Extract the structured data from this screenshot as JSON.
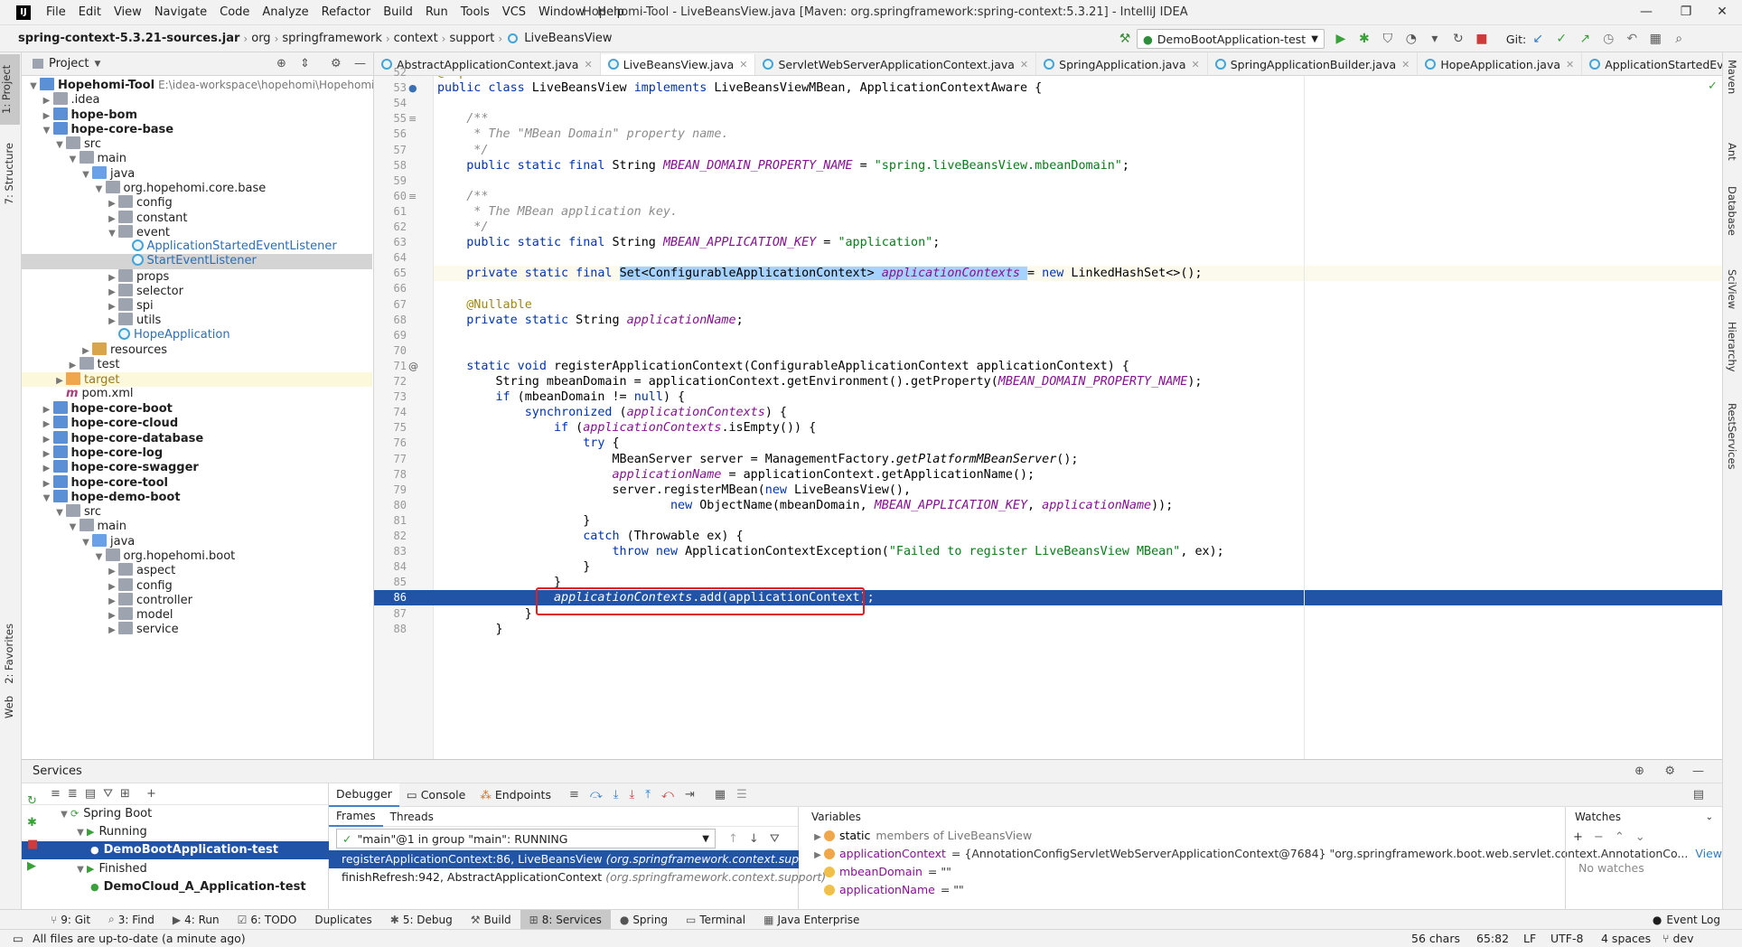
{
  "menubar": {
    "app_logo": "IJ",
    "items": [
      "File",
      "Edit",
      "View",
      "Navigate",
      "Code",
      "Analyze",
      "Refactor",
      "Build",
      "Run",
      "Tools",
      "VCS",
      "Window",
      "Help"
    ],
    "title": "Hopehomi-Tool - LiveBeansView.java [Maven: org.springframework:spring-context:5.3.21] - IntelliJ IDEA"
  },
  "navbar": {
    "crumbs": [
      "spring-context-5.3.21-sources.jar",
      "org",
      "springframework",
      "context",
      "support",
      "LiveBeansView"
    ],
    "run_config": "DemoBootApplication-test",
    "git_label": "Git:"
  },
  "left_tabs": [
    "1: Project",
    "7: Structure",
    "2: Favorites",
    "Web"
  ],
  "right_tabs": [
    "Maven",
    "Ant",
    "Database",
    "SciView",
    "Hierarchy",
    "RestServices"
  ],
  "project": {
    "header": "Project",
    "tree": [
      {
        "text": "Hopehomi-Tool",
        "extra": "E:\\idea-workspace\\hopehomi\\Hopehomi-",
        "kind": "module",
        "level": 0,
        "arrow": "▼"
      },
      {
        "text": ".idea",
        "kind": "folder",
        "level": 1,
        "arrow": "▶"
      },
      {
        "text": "hope-bom",
        "kind": "module",
        "level": 1,
        "arrow": "▶"
      },
      {
        "text": "hope-core-base",
        "kind": "module",
        "level": 1,
        "arrow": "▼"
      },
      {
        "text": "src",
        "kind": "folder",
        "level": 2,
        "arrow": "▼"
      },
      {
        "text": "main",
        "kind": "folder",
        "level": 3,
        "arrow": "▼"
      },
      {
        "text": "java",
        "kind": "src",
        "level": 4,
        "arrow": "▼"
      },
      {
        "text": "org.hopehomi.core.base",
        "kind": "folder",
        "level": 5,
        "arrow": "▼"
      },
      {
        "text": "config",
        "kind": "folder",
        "level": 6,
        "arrow": "▶"
      },
      {
        "text": "constant",
        "kind": "folder",
        "level": 6,
        "arrow": "▶"
      },
      {
        "text": "event",
        "kind": "folder",
        "level": 6,
        "arrow": "▼"
      },
      {
        "text": "ApplicationStartedEventListener",
        "kind": "class",
        "level": 7,
        "arrow": ""
      },
      {
        "text": "StartEventListener",
        "kind": "class",
        "level": 7,
        "arrow": "",
        "selected": true
      },
      {
        "text": "props",
        "kind": "folder",
        "level": 6,
        "arrow": "▶"
      },
      {
        "text": "selector",
        "kind": "folder",
        "level": 6,
        "arrow": "▶"
      },
      {
        "text": "spi",
        "kind": "folder",
        "level": 6,
        "arrow": "▶"
      },
      {
        "text": "utils",
        "kind": "folder",
        "level": 6,
        "arrow": "▶"
      },
      {
        "text": "HopeApplication",
        "kind": "class",
        "level": 6,
        "arrow": ""
      },
      {
        "text": "resources",
        "kind": "res",
        "level": 4,
        "arrow": "▶"
      },
      {
        "text": "test",
        "kind": "folder",
        "level": 3,
        "arrow": "▶"
      },
      {
        "text": "target",
        "kind": "target",
        "level": 2,
        "arrow": "▶",
        "highlight": true
      },
      {
        "text": "pom.xml",
        "kind": "pom",
        "level": 2,
        "arrow": ""
      },
      {
        "text": "hope-core-boot",
        "kind": "module",
        "level": 1,
        "arrow": "▶"
      },
      {
        "text": "hope-core-cloud",
        "kind": "module",
        "level": 1,
        "arrow": "▶"
      },
      {
        "text": "hope-core-database",
        "kind": "module",
        "level": 1,
        "arrow": "▶"
      },
      {
        "text": "hope-core-log",
        "kind": "module",
        "level": 1,
        "arrow": "▶"
      },
      {
        "text": "hope-core-swagger",
        "kind": "module",
        "level": 1,
        "arrow": "▶"
      },
      {
        "text": "hope-core-tool",
        "kind": "module",
        "level": 1,
        "arrow": "▶"
      },
      {
        "text": "hope-demo-boot",
        "kind": "module",
        "level": 1,
        "arrow": "▼"
      },
      {
        "text": "src",
        "kind": "folder",
        "level": 2,
        "arrow": "▼"
      },
      {
        "text": "main",
        "kind": "folder",
        "level": 3,
        "arrow": "▼"
      },
      {
        "text": "java",
        "kind": "src",
        "level": 4,
        "arrow": "▼"
      },
      {
        "text": "org.hopehomi.boot",
        "kind": "folder",
        "level": 5,
        "arrow": "▼"
      },
      {
        "text": "aspect",
        "kind": "folder",
        "level": 6,
        "arrow": "▶"
      },
      {
        "text": "config",
        "kind": "folder",
        "level": 6,
        "arrow": "▶"
      },
      {
        "text": "controller",
        "kind": "folder",
        "level": 6,
        "arrow": "▶"
      },
      {
        "text": "model",
        "kind": "folder",
        "level": 6,
        "arrow": "▶"
      },
      {
        "text": "service",
        "kind": "folder",
        "level": 6,
        "arrow": "▶"
      }
    ]
  },
  "editor": {
    "tabs": [
      "AbstractApplicationContext.java",
      "LiveBeansView.java",
      "ServletWebServerApplicationContext.java",
      "SpringApplication.java",
      "SpringApplicationBuilder.java",
      "HopeApplication.java",
      "ApplicationStartedEventListener"
    ],
    "active_tab": 1,
    "lines": [
      {
        "n": "52",
        "html": "<span class='ann'>@Deprecated</span>"
      },
      {
        "n": "53",
        "html": "<span class='kw'>public class</span> LiveBeansView <span class='kw'>implements</span> LiveBeansViewMBean, ApplicationContextAware {"
      },
      {
        "n": "54",
        "html": ""
      },
      {
        "n": "55",
        "html": "    <span class='cm'>/**</span>"
      },
      {
        "n": "56",
        "html": "<span class='cm'>     * The \"MBean Domain\" property name.</span>"
      },
      {
        "n": "57",
        "html": "<span class='cm'>     */</span>"
      },
      {
        "n": "58",
        "html": "    <span class='kw'>public static final</span> String <span class='fld'>MBEAN_DOMAIN_PROPERTY_NAME</span> = <span class='str'>\"spring.liveBeansView.mbeanDomain\"</span>;"
      },
      {
        "n": "59",
        "html": ""
      },
      {
        "n": "60",
        "html": "    <span class='cm'>/**</span>"
      },
      {
        "n": "61",
        "html": "<span class='cm'>     * The MBean application key.</span>"
      },
      {
        "n": "62",
        "html": "<span class='cm'>     */</span>"
      },
      {
        "n": "63",
        "html": "    <span class='kw'>public static final</span> String <span class='fld'>MBEAN_APPLICATION_KEY</span> = <span class='str'>\"application\"</span>;"
      },
      {
        "n": "64",
        "html": ""
      },
      {
        "n": "65",
        "html": "    <span class='kw'>private static final</span> <span class='sel-text'>Set&lt;ConfigurableApplicationContext&gt; <span class='fld'>applicationContexts</span> </span>= <span class='kw'>new</span> LinkedHashSet&lt;&gt;();",
        "cur": true
      },
      {
        "n": "66",
        "html": ""
      },
      {
        "n": "67",
        "html": "    <span class='ann'>@Nullable</span>"
      },
      {
        "n": "68",
        "html": "    <span class='kw'>private static</span> String <span class='fld'>applicationName</span>;"
      },
      {
        "n": "69",
        "html": ""
      },
      {
        "n": "70",
        "html": ""
      },
      {
        "n": "71",
        "html": "    <span class='kw'>static void</span> registerApplicationContext(ConfigurableApplicationContext applicationContext) {"
      },
      {
        "n": "72",
        "html": "        String mbeanDomain = applicationContext.getEnvironment().getProperty(<span class='fld'>MBEAN_DOMAIN_PROPERTY_NAME</span>);"
      },
      {
        "n": "73",
        "html": "        <span class='kw'>if</span> (mbeanDomain != <span class='kw'>null</span>) {"
      },
      {
        "n": "74",
        "html": "            <span class='kw'>synchronized</span> (<span class='fld'>applicationContexts</span>) {"
      },
      {
        "n": "75",
        "html": "                <span class='kw'>if</span> (<span class='fld'>applicationContexts</span>.isEmpty()) {"
      },
      {
        "n": "76",
        "html": "                    <span class='kw'>try</span> {"
      },
      {
        "n": "77",
        "html": "                        MBeanServer server = ManagementFactory.<i>getPlatformMBeanServer</i>();"
      },
      {
        "n": "78",
        "html": "                        <span class='fld'>applicationName</span> = applicationContext.getApplicationName();"
      },
      {
        "n": "79",
        "html": "                        server.registerMBean(<span class='kw'>new</span> LiveBeansView(),"
      },
      {
        "n": "80",
        "html": "                                <span class='kw'>new</span> ObjectName(mbeanDomain, <span class='fld'>MBEAN_APPLICATION_KEY</span>, <span class='fld'>applicationName</span>));"
      },
      {
        "n": "81",
        "html": "                    }"
      },
      {
        "n": "82",
        "html": "                    <span class='kw'>catch</span> (Throwable ex) {"
      },
      {
        "n": "83",
        "html": "                        <span class='kw'>throw new</span> ApplicationContextException(<span class='str'>\"Failed to register LiveBeansView MBean\"</span>, ex);"
      },
      {
        "n": "84",
        "html": "                    }"
      },
      {
        "n": "85",
        "html": "                }"
      },
      {
        "n": "86",
        "html": "                <i>applicationContexts</i>.add(applicationContext);",
        "exec": true
      },
      {
        "n": "87",
        "html": "            }"
      },
      {
        "n": "88",
        "html": "        }"
      }
    ]
  },
  "services": {
    "title": "Services",
    "tree": [
      {
        "text": "Spring Boot",
        "level": 0,
        "arrow": "▼"
      },
      {
        "text": "Running",
        "level": 1,
        "arrow": "▼"
      },
      {
        "text": "DemoBootApplication-test",
        "level": 2,
        "arrow": "",
        "selected": true
      },
      {
        "text": "Finished",
        "level": 1,
        "arrow": "▼"
      },
      {
        "text": "DemoCloud_A_Application-test",
        "level": 2,
        "arrow": "",
        "bold": true
      }
    ],
    "debug_tabs": [
      "Debugger",
      "Console",
      "Endpoints"
    ],
    "frames_tabs": [
      "Frames",
      "Threads"
    ],
    "thread_select": "\"main\"@1 in group \"main\": RUNNING",
    "frames": [
      {
        "text": "registerApplicationContext:86, LiveBeansView",
        "pkg": "(org.springframework.context.support)",
        "selected": true
      },
      {
        "text": "finishRefresh:942, AbstractApplicationContext",
        "pkg": "(org.springframework.context.support)"
      }
    ],
    "variables_title": "Variables",
    "variables": [
      {
        "name": "static",
        "value": "members of LiveBeansView"
      },
      {
        "name": "applicationContext",
        "value": "= {AnnotationConfigServletWebServerApplicationContext@7684} \"org.springframework.boot.web.servlet.context.AnnotationCo...",
        "link": "View"
      },
      {
        "name": "mbeanDomain",
        "value": "= \"\""
      },
      {
        "name": "applicationName",
        "value": "= \"\""
      }
    ],
    "watches_title": "Watches",
    "watches_empty": "No watches"
  },
  "bottom_tabs": [
    "9: Git",
    "3: Find",
    "4: Run",
    "6: TODO",
    "Duplicates",
    "5: Debug",
    "Build",
    "8: Services",
    "Spring",
    "Terminal",
    "Java Enterprise"
  ],
  "bottom_active": 7,
  "event_log": "Event Log",
  "status": {
    "message": "All files are up-to-date (a minute ago)",
    "chars": "56 chars",
    "pos": "65:82",
    "eol": "LF",
    "enc": "UTF-8",
    "indent": "4 spaces",
    "branch": "dev"
  }
}
